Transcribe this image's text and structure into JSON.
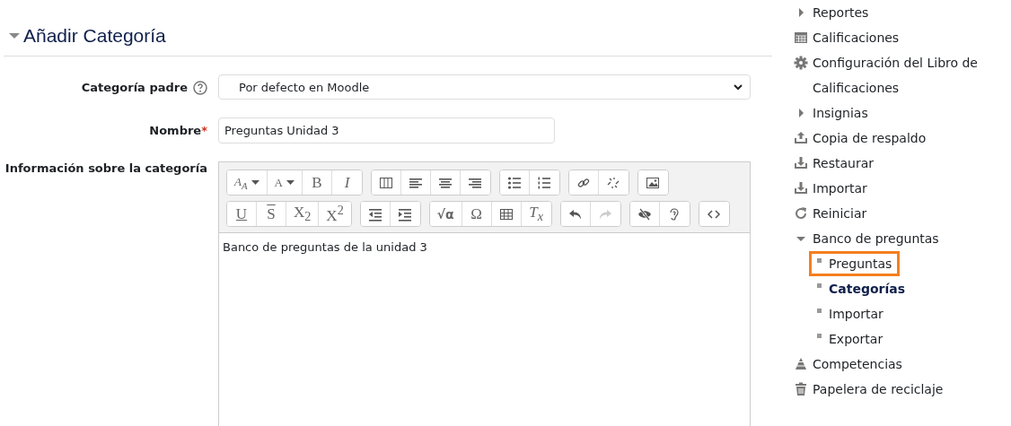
{
  "section": {
    "title": "Añadir Categoría",
    "expanded": true
  },
  "form": {
    "parent": {
      "label": "Categoría padre",
      "value": "Por defecto en Moodle"
    },
    "name": {
      "label": "Nombre",
      "required_mark": "*",
      "value": "Preguntas Unidad 3"
    },
    "info": {
      "label": "Información sobre la categoría",
      "content": "Banco de preguntas de la unidad 3",
      "toolbar": [
        [
          [
            {
              "kind": "font-family",
              "glyph": "A$_{A}$"
            },
            {
              "kind": "font-color",
              "glyph": "A"
            },
            {
              "kind": "bold",
              "glyph": "B"
            },
            {
              "kind": "italic",
              "glyph": "I"
            }
          ],
          [
            {
              "kind": "columns"
            },
            {
              "kind": "align-left"
            },
            {
              "kind": "align-center"
            },
            {
              "kind": "align-right"
            }
          ],
          [
            {
              "kind": "bullet-list"
            },
            {
              "kind": "numbered-list"
            }
          ],
          [
            {
              "kind": "link"
            },
            {
              "kind": "unlink"
            }
          ],
          [
            {
              "kind": "image"
            }
          ]
        ],
        [
          [
            {
              "kind": "underline",
              "glyph": "U"
            },
            {
              "kind": "strike",
              "glyph": "S"
            },
            {
              "kind": "subscript",
              "glyph": "X$_{2}$"
            },
            {
              "kind": "superscript",
              "glyph": "X$^{2}$"
            }
          ],
          [
            {
              "kind": "outdent"
            },
            {
              "kind": "indent"
            }
          ],
          [
            {
              "kind": "equation",
              "glyph": "√α"
            },
            {
              "kind": "special-char",
              "glyph": "Ω"
            },
            {
              "kind": "table"
            },
            {
              "kind": "clear-format",
              "glyph": "T$_{x}$"
            }
          ],
          [
            {
              "kind": "undo",
              "disabled": false
            },
            {
              "kind": "redo",
              "disabled": true
            }
          ],
          [
            {
              "kind": "accessibility"
            },
            {
              "kind": "screen-reader"
            }
          ],
          [
            {
              "kind": "html"
            }
          ]
        ]
      ]
    }
  },
  "sidebar": {
    "items": [
      {
        "kind": "caret",
        "label": "Reportes",
        "expanded": false
      },
      {
        "kind": "grid",
        "label": "Calificaciones"
      },
      {
        "kind": "gear",
        "label": "Configuración del Libro de Calificaciones"
      },
      {
        "kind": "caret",
        "label": "Insignias",
        "expanded": false
      },
      {
        "kind": "upload",
        "label": "Copia de respaldo"
      },
      {
        "kind": "download",
        "label": "Restaurar"
      },
      {
        "kind": "download",
        "label": "Importar"
      },
      {
        "kind": "reset",
        "label": "Reiniciar"
      },
      {
        "kind": "caret",
        "label": "Banco de preguntas",
        "expanded": true,
        "children": [
          {
            "label": "Preguntas",
            "selected": false,
            "highlighted": true
          },
          {
            "label": "Categorías",
            "selected": true,
            "highlighted": false
          },
          {
            "label": "Importar",
            "selected": false,
            "highlighted": false
          },
          {
            "label": "Exportar",
            "selected": false,
            "highlighted": false
          }
        ]
      },
      {
        "kind": "pyramid",
        "label": "Competencias"
      },
      {
        "kind": "trash",
        "label": "Papelera de reciclaje"
      }
    ]
  }
}
